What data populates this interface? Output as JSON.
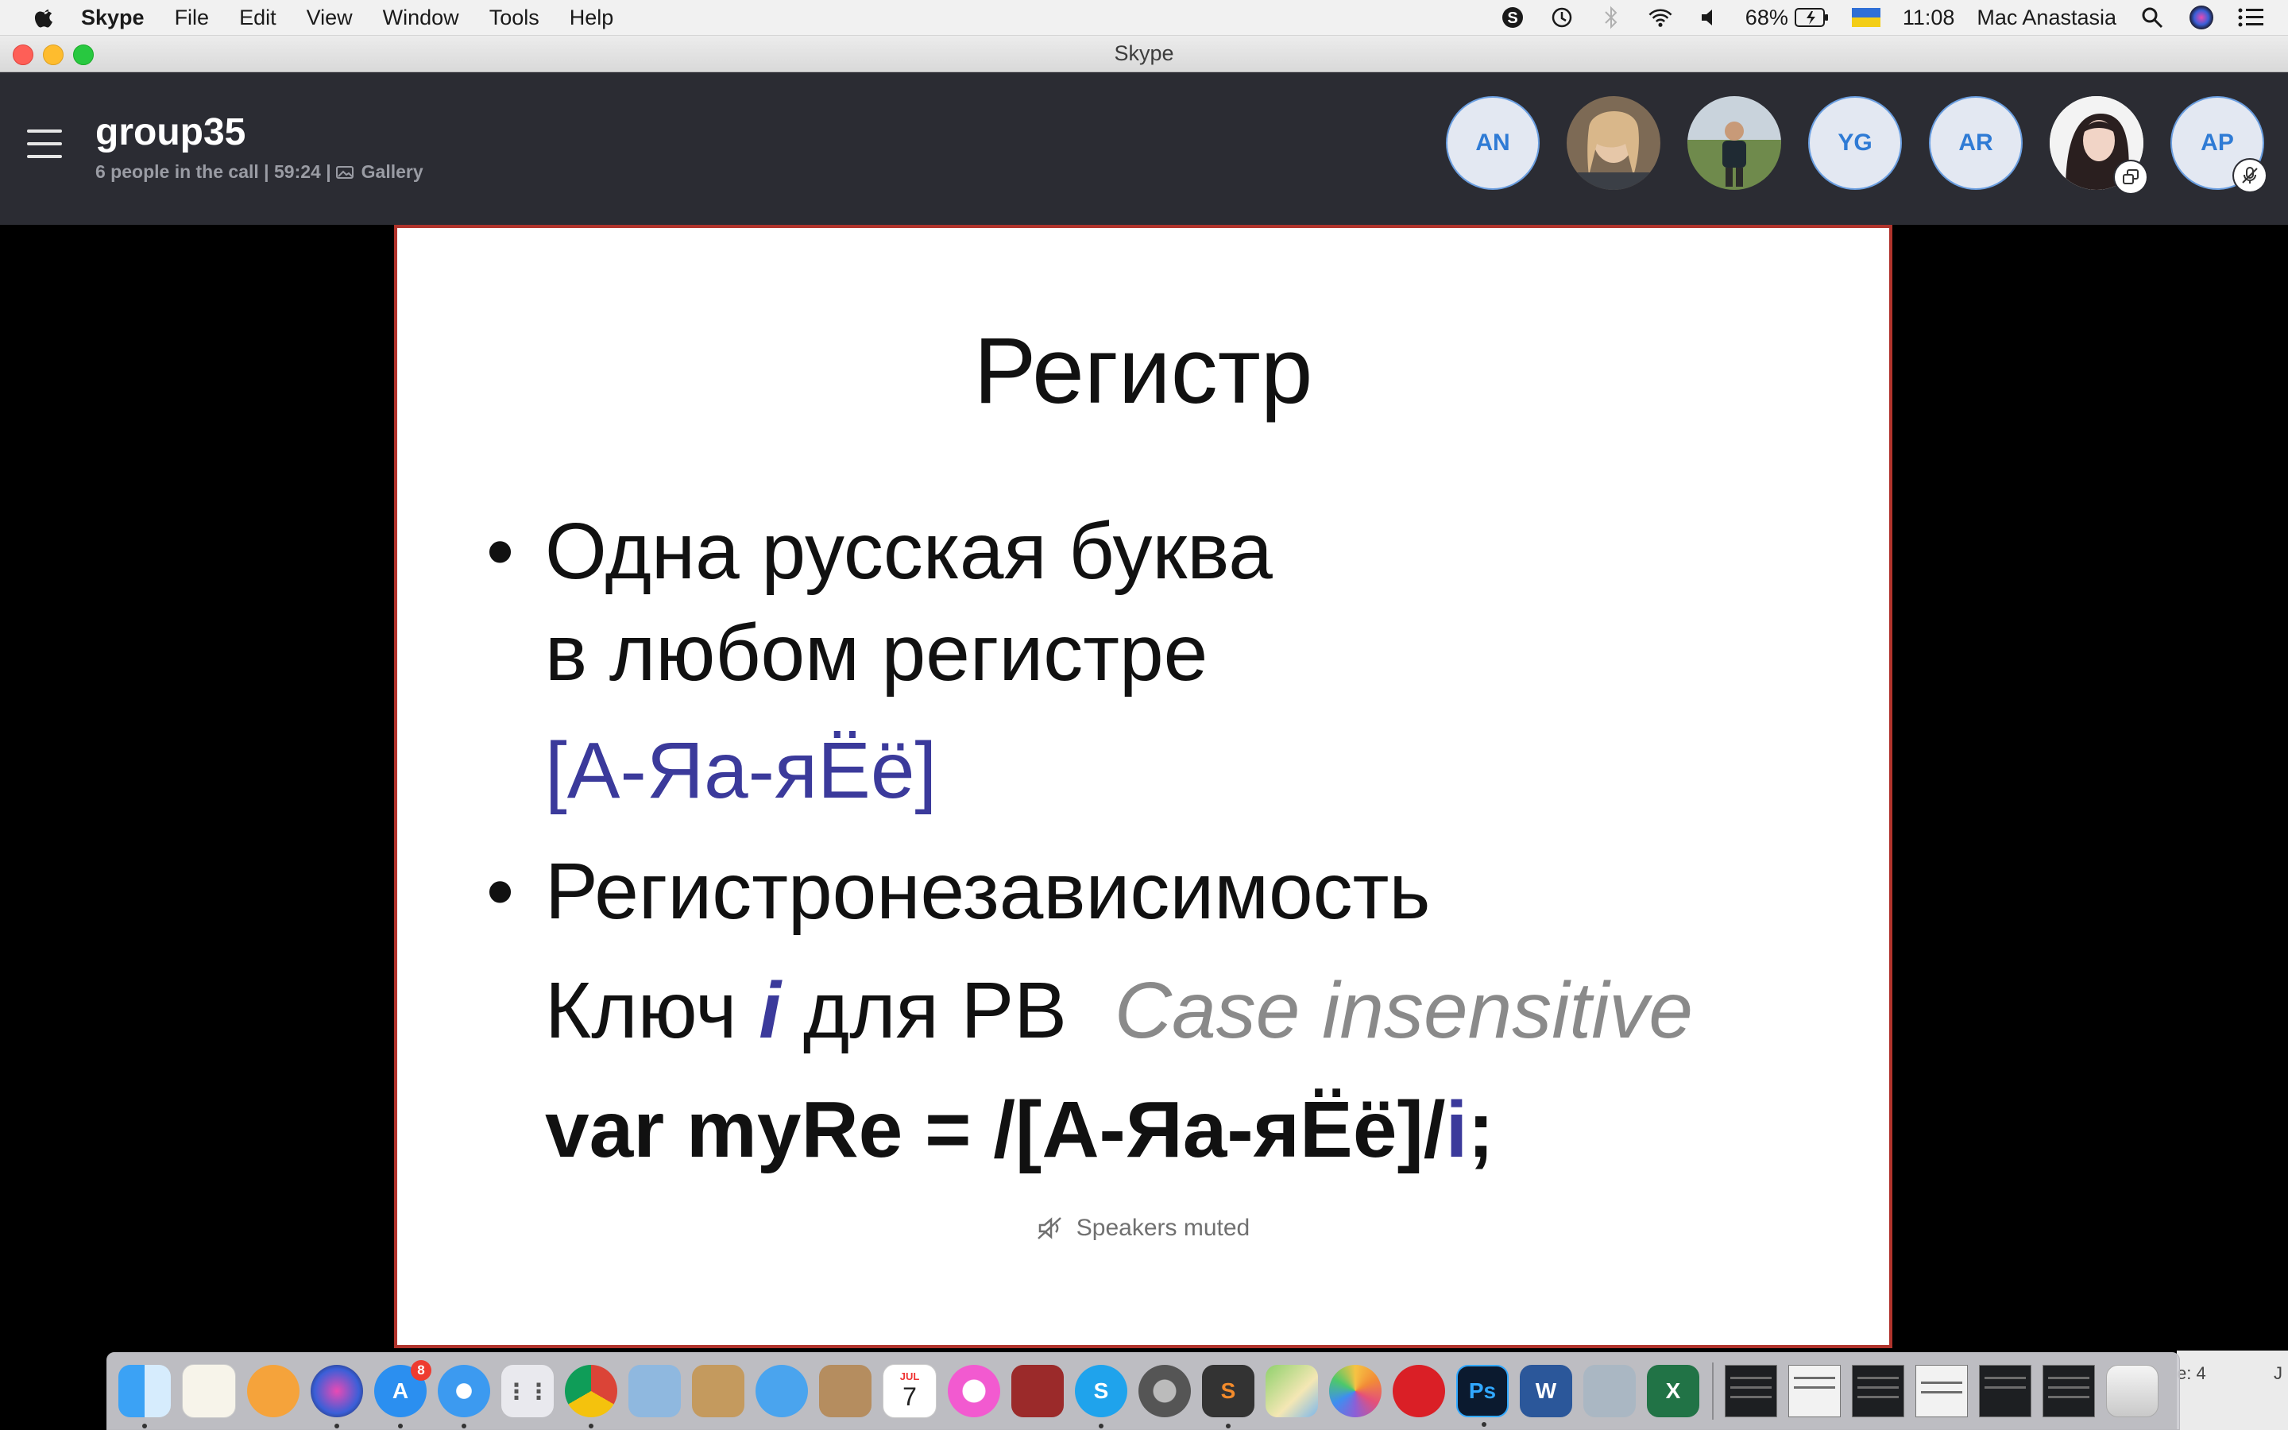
{
  "menubar": {
    "app_name": "Skype",
    "items": [
      "File",
      "Edit",
      "View",
      "Window",
      "Tools",
      "Help"
    ],
    "battery": "68%",
    "time": "11:08",
    "user": "Mac Anastasia"
  },
  "window": {
    "title": "Skype"
  },
  "call": {
    "title": "group35",
    "subtitle": "6 people in the call | 59:24  |",
    "view_label": "Gallery",
    "participants": [
      {
        "initials": "AN",
        "type": "initials"
      },
      {
        "type": "photo",
        "icon": "person-photo"
      },
      {
        "type": "photo",
        "icon": "person-photo"
      },
      {
        "initials": "YG",
        "type": "initials"
      },
      {
        "initials": "AR",
        "type": "initials"
      },
      {
        "type": "photo",
        "icon": "person-photo",
        "badge": "screen-share-icon"
      },
      {
        "initials": "AP",
        "type": "initials",
        "badge": "mic-muted-icon"
      }
    ]
  },
  "slide": {
    "title": "Регистр",
    "bullet1_line1": "Одна русская буква",
    "bullet1_line2": "в любом регистре",
    "pattern": "[А-Яа-яЁё]",
    "bullet2": "Регистронезависимость",
    "key_prefix": "Ключ ",
    "key_letter": "i",
    "key_suffix": " для РВ",
    "case_hint": "Case insensitive",
    "code_prefix": "var myRe = /[А-Яа-яЁё]/",
    "code_flag": "i",
    "code_end": ";",
    "status_note": "Speakers muted"
  },
  "dock": {
    "shelf_text": "e: 4",
    "shelf_text2": "J",
    "appstore_badge": "8",
    "calendar_month": "JUL",
    "calendar_day": "7"
  },
  "colors": {
    "accent_blue": "#2f7bd5",
    "slide_border": "#b0332c",
    "regex_blue": "#3b3a9b",
    "header_bg": "#2b2c33"
  }
}
